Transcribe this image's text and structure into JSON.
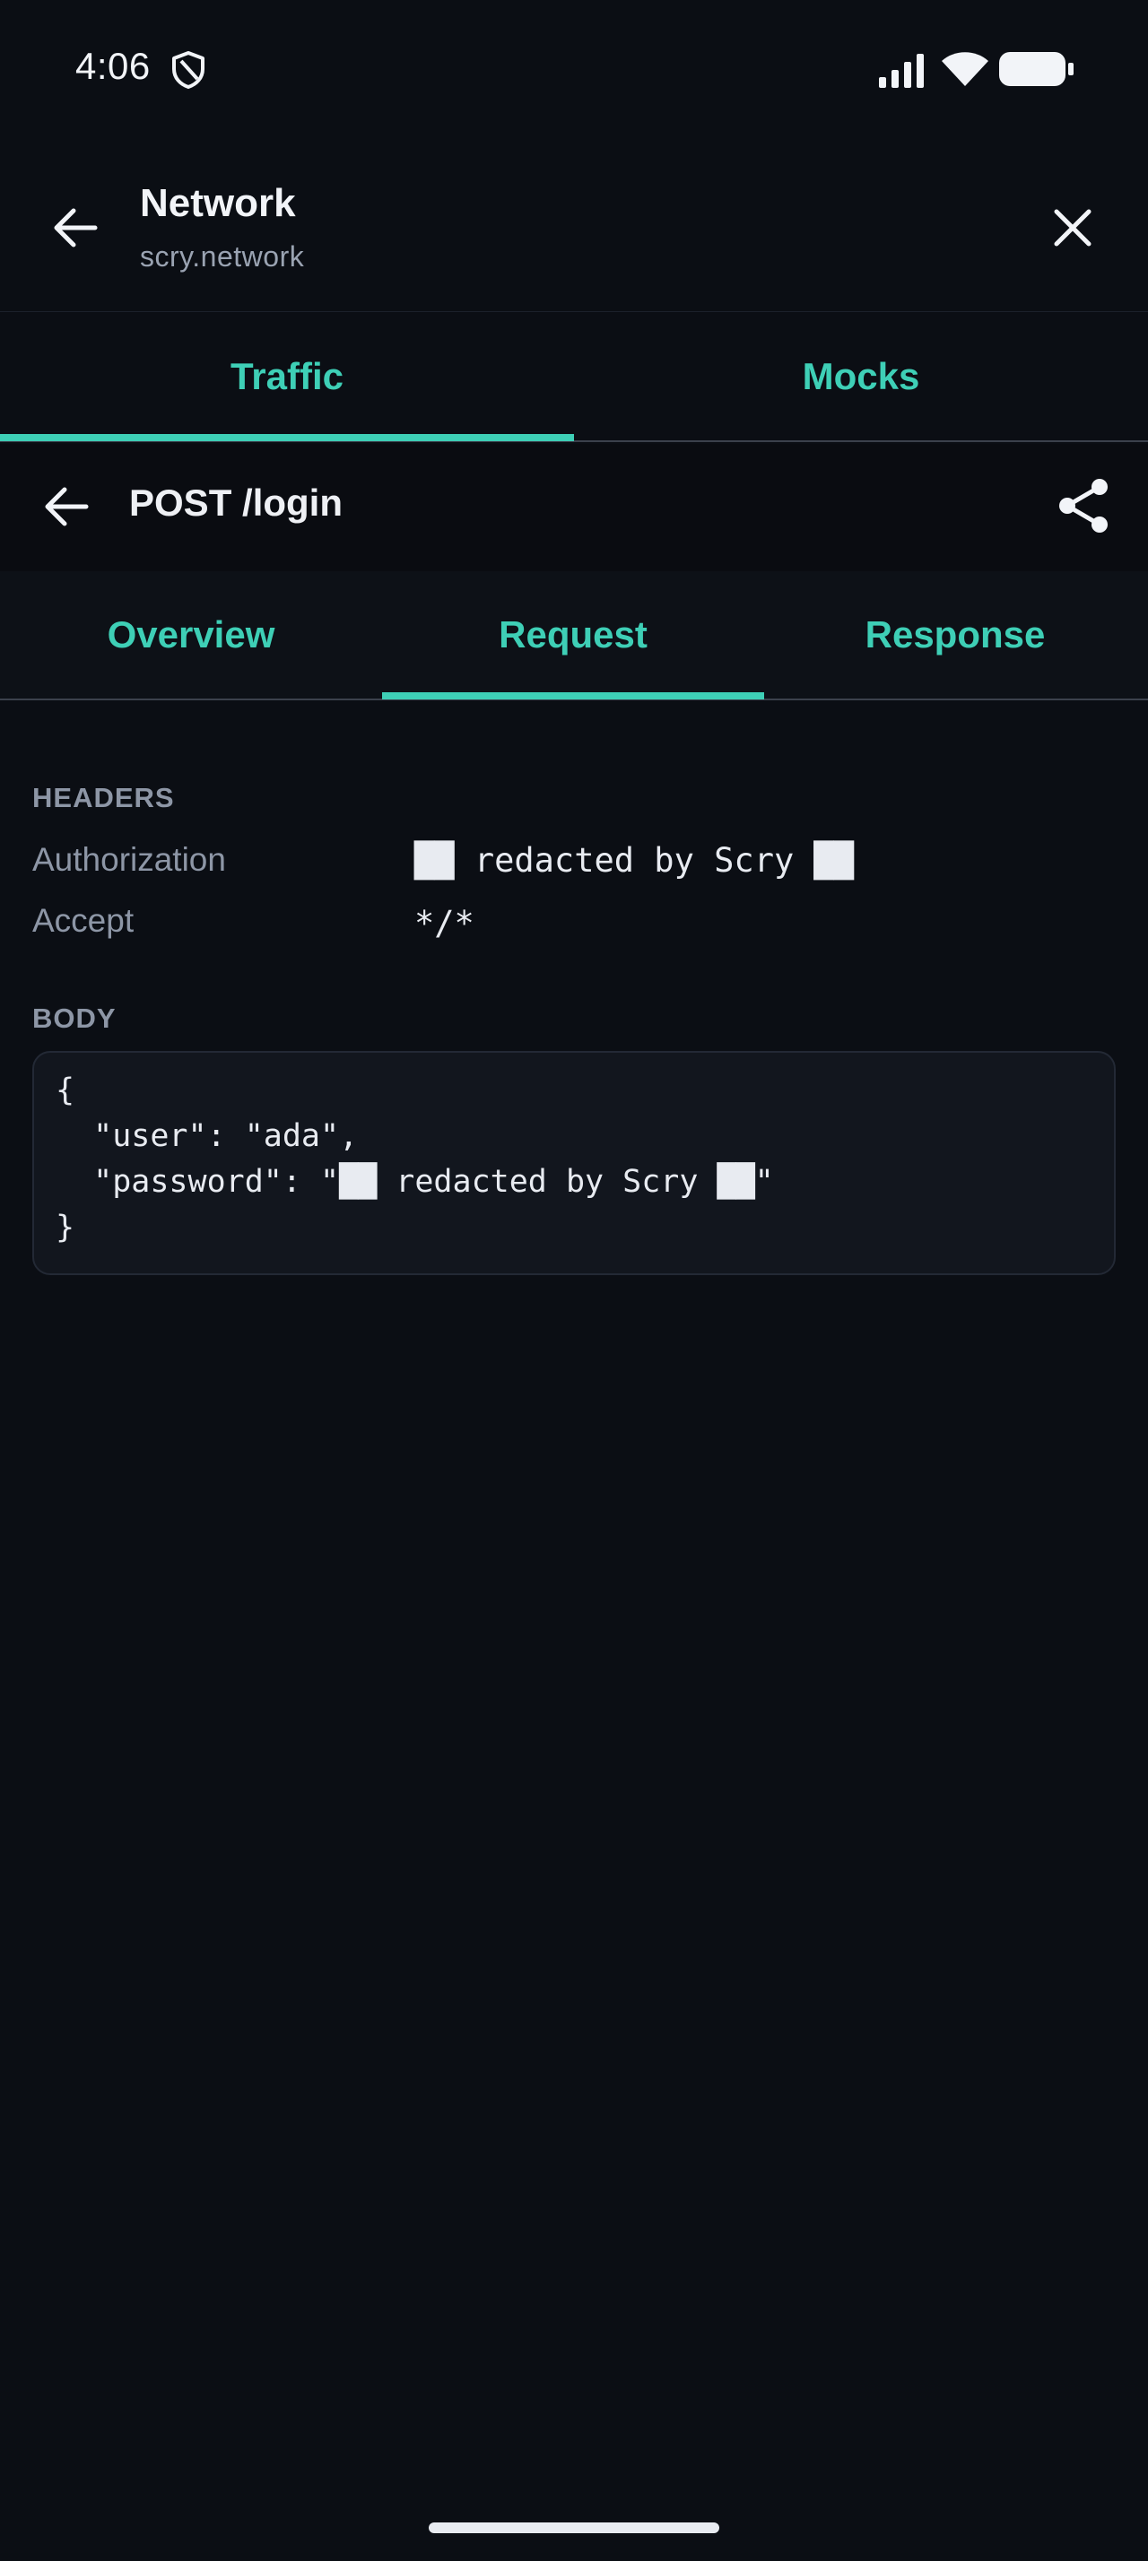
{
  "status_bar": {
    "time": "4:06",
    "icons": [
      "shield-icon",
      "signal-icon",
      "wifi-icon",
      "battery-icon"
    ]
  },
  "header": {
    "title": "Network",
    "subtitle": "scry.network",
    "back_icon": "arrow-left-icon",
    "close_icon": "close-icon"
  },
  "main_tabs": [
    {
      "label": "Traffic",
      "selected": true
    },
    {
      "label": "Mocks",
      "selected": false
    }
  ],
  "request_detail": {
    "title": "POST /login",
    "back_icon": "arrow-left-icon",
    "share_icon": "share-icon"
  },
  "sub_tabs": [
    {
      "label": "Overview",
      "selected": false
    },
    {
      "label": "Request",
      "selected": true
    },
    {
      "label": "Response",
      "selected": false
    }
  ],
  "headers_section": {
    "label": "HEADERS",
    "rows": [
      {
        "name": "Authorization",
        "value": "██ redacted by Scry ██"
      },
      {
        "name": "Accept",
        "value": "*/*"
      }
    ]
  },
  "body_section": {
    "label": "BODY",
    "lines": [
      "{",
      "  \"user\": \"ada\",",
      "  \"password\": \"██ redacted by Scry ██\"",
      "}"
    ]
  },
  "colors": {
    "background": "#0b0e14",
    "accent": "#3ecfb6",
    "muted_text": "#8d96a6"
  }
}
